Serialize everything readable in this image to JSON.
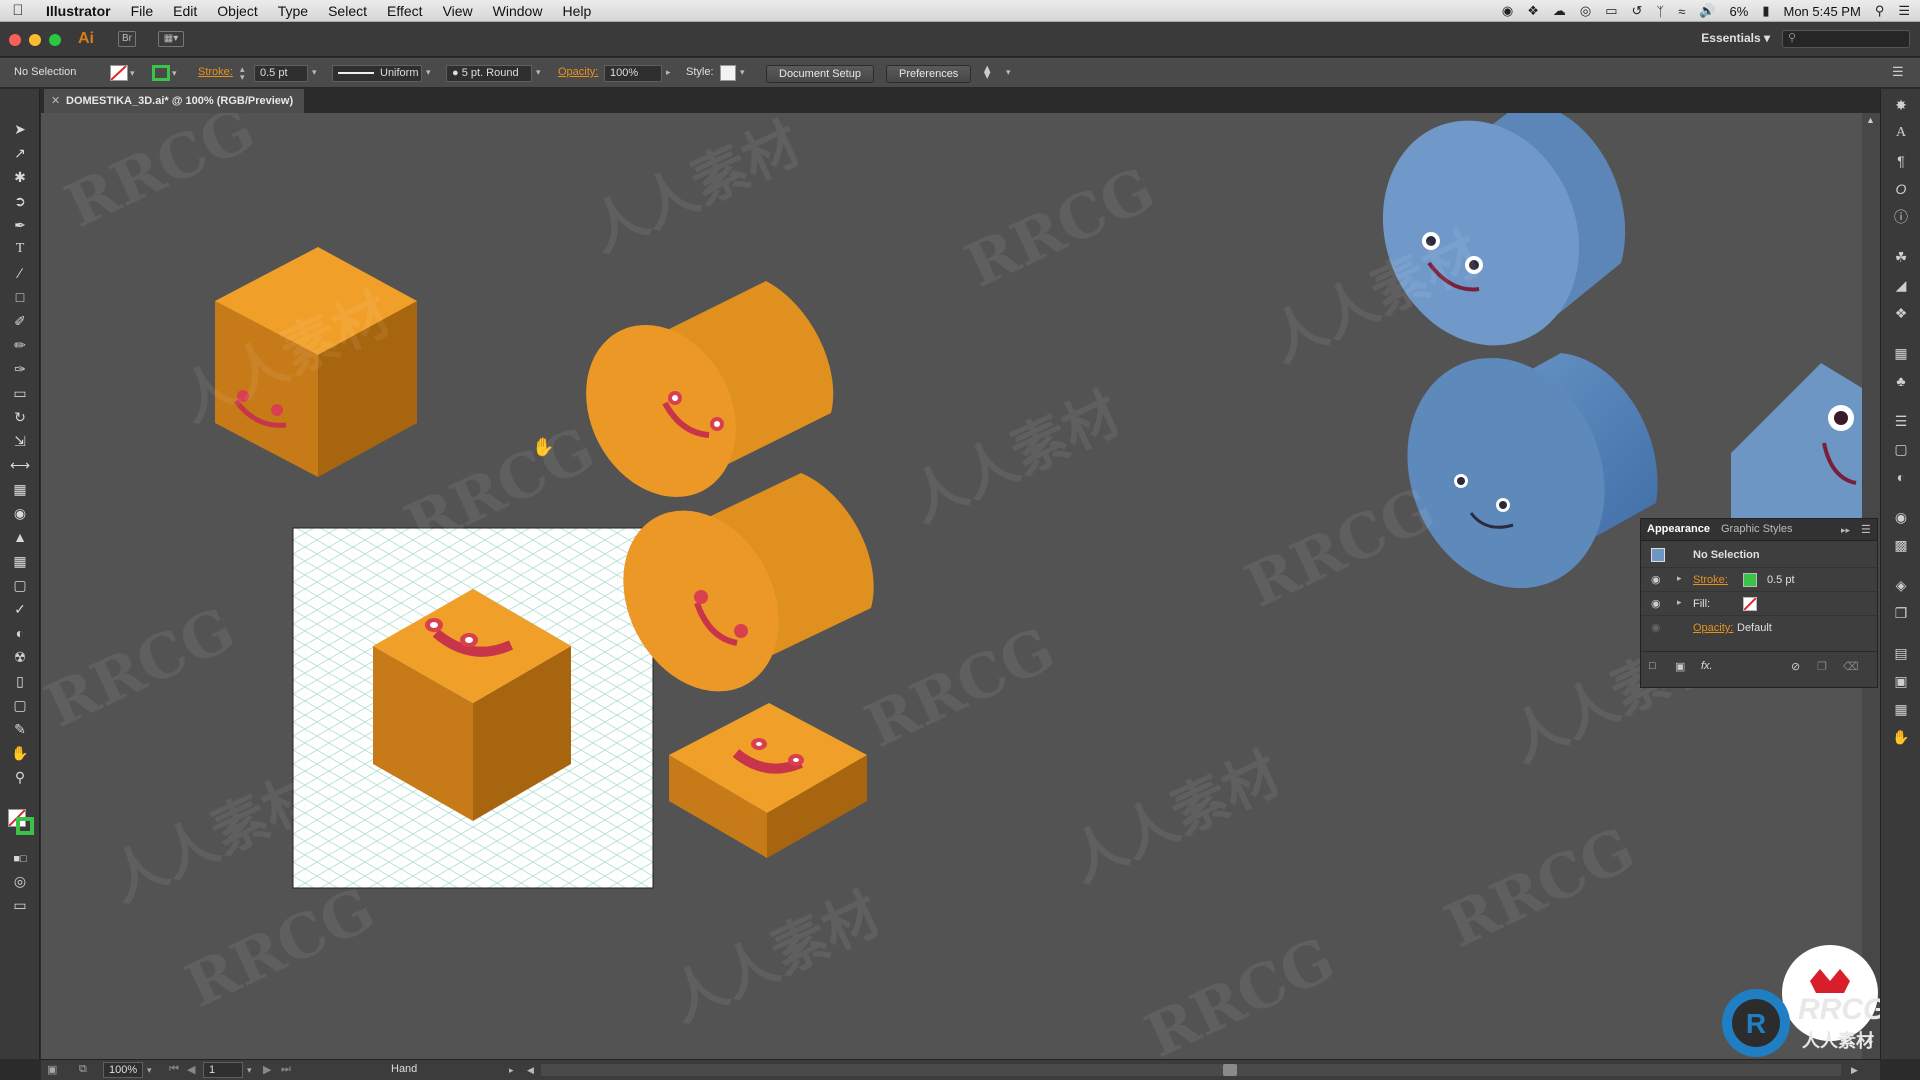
{
  "menubar": {
    "app_name": "Illustrator",
    "items": [
      "File",
      "Edit",
      "Object",
      "Type",
      "Select",
      "Effect",
      "View",
      "Window",
      "Help"
    ],
    "battery": "6%",
    "clock": "Mon 5:45 PM"
  },
  "appbar": {
    "logo": "Ai",
    "bridge_label": "Br",
    "workspace": "Essentials"
  },
  "control": {
    "selection": "No Selection",
    "stroke_label": "Stroke:",
    "stroke_weight": "0.5 pt",
    "profile": "Uniform",
    "brush": "5 pt. Round",
    "opacity_label": "Opacity:",
    "opacity_value": "100%",
    "style_label": "Style:",
    "document_setup": "Document Setup",
    "preferences": "Preferences"
  },
  "document": {
    "tab_title": "DOMESTIKA_3D.ai* @ 100% (RGB/Preview)"
  },
  "status": {
    "zoom": "100%",
    "artboard": "1",
    "tool": "Hand"
  },
  "appearance_panel": {
    "tab_appearance": "Appearance",
    "tab_graphic_styles": "Graphic Styles",
    "header": "No Selection",
    "stroke_label": "Stroke:",
    "stroke_value": "0.5 pt",
    "fill_label": "Fill:",
    "opacity_label": "Opacity:",
    "opacity_value": "Default",
    "fx_label": "fx."
  },
  "watermarks": [
    "RRCG",
    "人人素材"
  ],
  "colors": {
    "accent_orange": "#e8901e",
    "cube_top": "#f0a028",
    "cube_left": "#c77a18",
    "cube_right": "#a8650f",
    "cyl_blue": "#6d96c4",
    "stroke_green": "#3bc24a",
    "smile_red": "#c8344a"
  }
}
